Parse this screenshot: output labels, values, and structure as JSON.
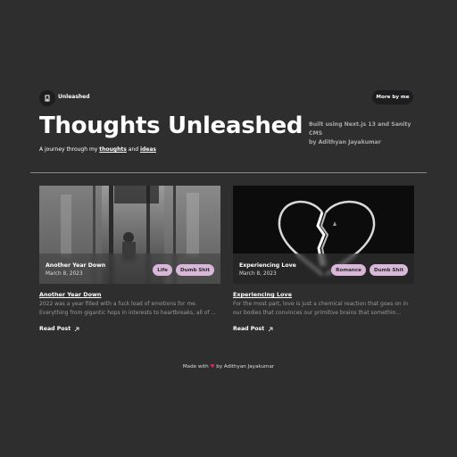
{
  "header": {
    "brand": "Unleashed",
    "nav_button": "More by me",
    "title": "Thoughts Unleashed",
    "tagline_prefix": "A journey through my",
    "tagline_link1": "thoughts",
    "tagline_and": "and",
    "tagline_link2": "ideas",
    "built_line1": "Built using Next.js 13 and Sanity CMS",
    "built_line2": "by Adithyan Jayakumar"
  },
  "posts": [
    {
      "overlay_title": "Another Year Down",
      "date": "March 8, 2023",
      "tags": [
        "Life",
        "Dumb Shit"
      ],
      "title": "Another Year Down",
      "excerpt": "2022 was a year filled with a fuck load of emotions for me. Everything from gigantic hops in interests to heartbreaks, all of ...",
      "read_label": "Read Post"
    },
    {
      "overlay_title": "Experiencing Love",
      "date": "March 8, 2023",
      "tags": [
        "Romance",
        "Dumb Shit"
      ],
      "title": "Experiencing Love",
      "excerpt": "For the most part, love is just a chemical reaction that goes on in our bodies that convinces our primitive brains that somethin...",
      "read_label": "Read Post"
    }
  ],
  "footer": {
    "prefix": "Made with",
    "heart": "♥",
    "suffix": "by Adithyan Jayakumar"
  },
  "colors": {
    "background": "#2e2e2e",
    "tag": "#d8b7d8",
    "button": "#1d1d1f"
  },
  "icons": [
    "logo-icon",
    "arrow-up-right-icon",
    "heart-icon"
  ]
}
